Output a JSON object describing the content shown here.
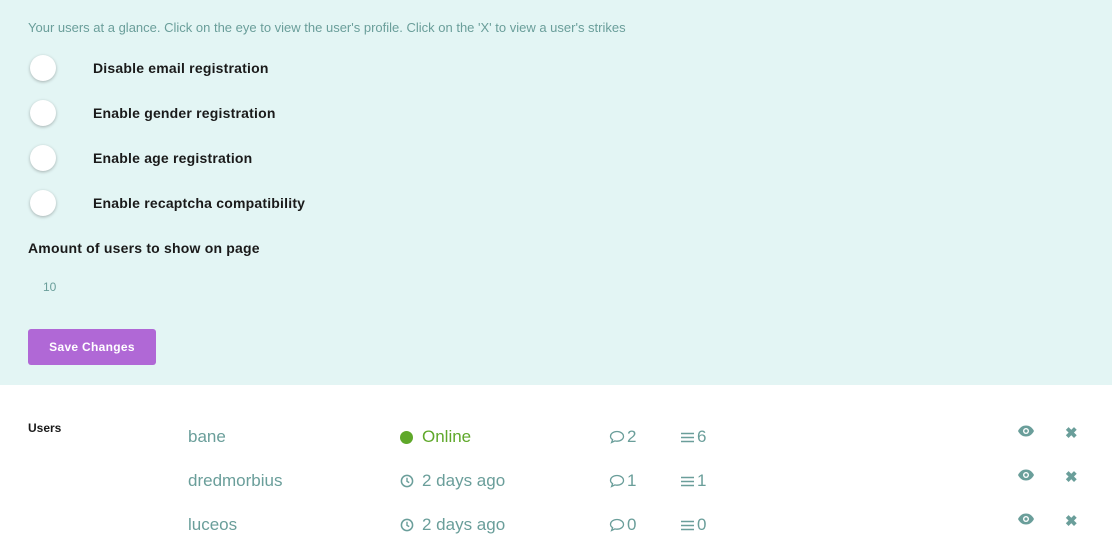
{
  "settings": {
    "intro": "Your users at a glance. Click on the eye to view the user's profile. Click on the 'X' to view a user's strikes",
    "toggles": [
      {
        "label": "Disable email registration"
      },
      {
        "label": "Enable gender registration"
      },
      {
        "label": "Enable age registration"
      },
      {
        "label": "Enable recaptcha compatibility"
      }
    ],
    "amount_label": "Amount of users to show on page",
    "amount_value": "10",
    "save_label": "Save Changes"
  },
  "users": {
    "heading": "Users",
    "rows": [
      {
        "name": "bane",
        "status": "Online",
        "posts": "2",
        "threads": "6"
      },
      {
        "name": "dredmorbius",
        "status": "2 days ago",
        "posts": "1",
        "threads": "1"
      },
      {
        "name": "luceos",
        "status": "2 days ago",
        "posts": "0",
        "threads": "0"
      }
    ],
    "strike_symbol": "✖"
  },
  "colors": {
    "panel_bg": "#e3f5f4",
    "accent": "#b068d6",
    "online": "#5fa82a",
    "muted": "#6a9e9a"
  }
}
